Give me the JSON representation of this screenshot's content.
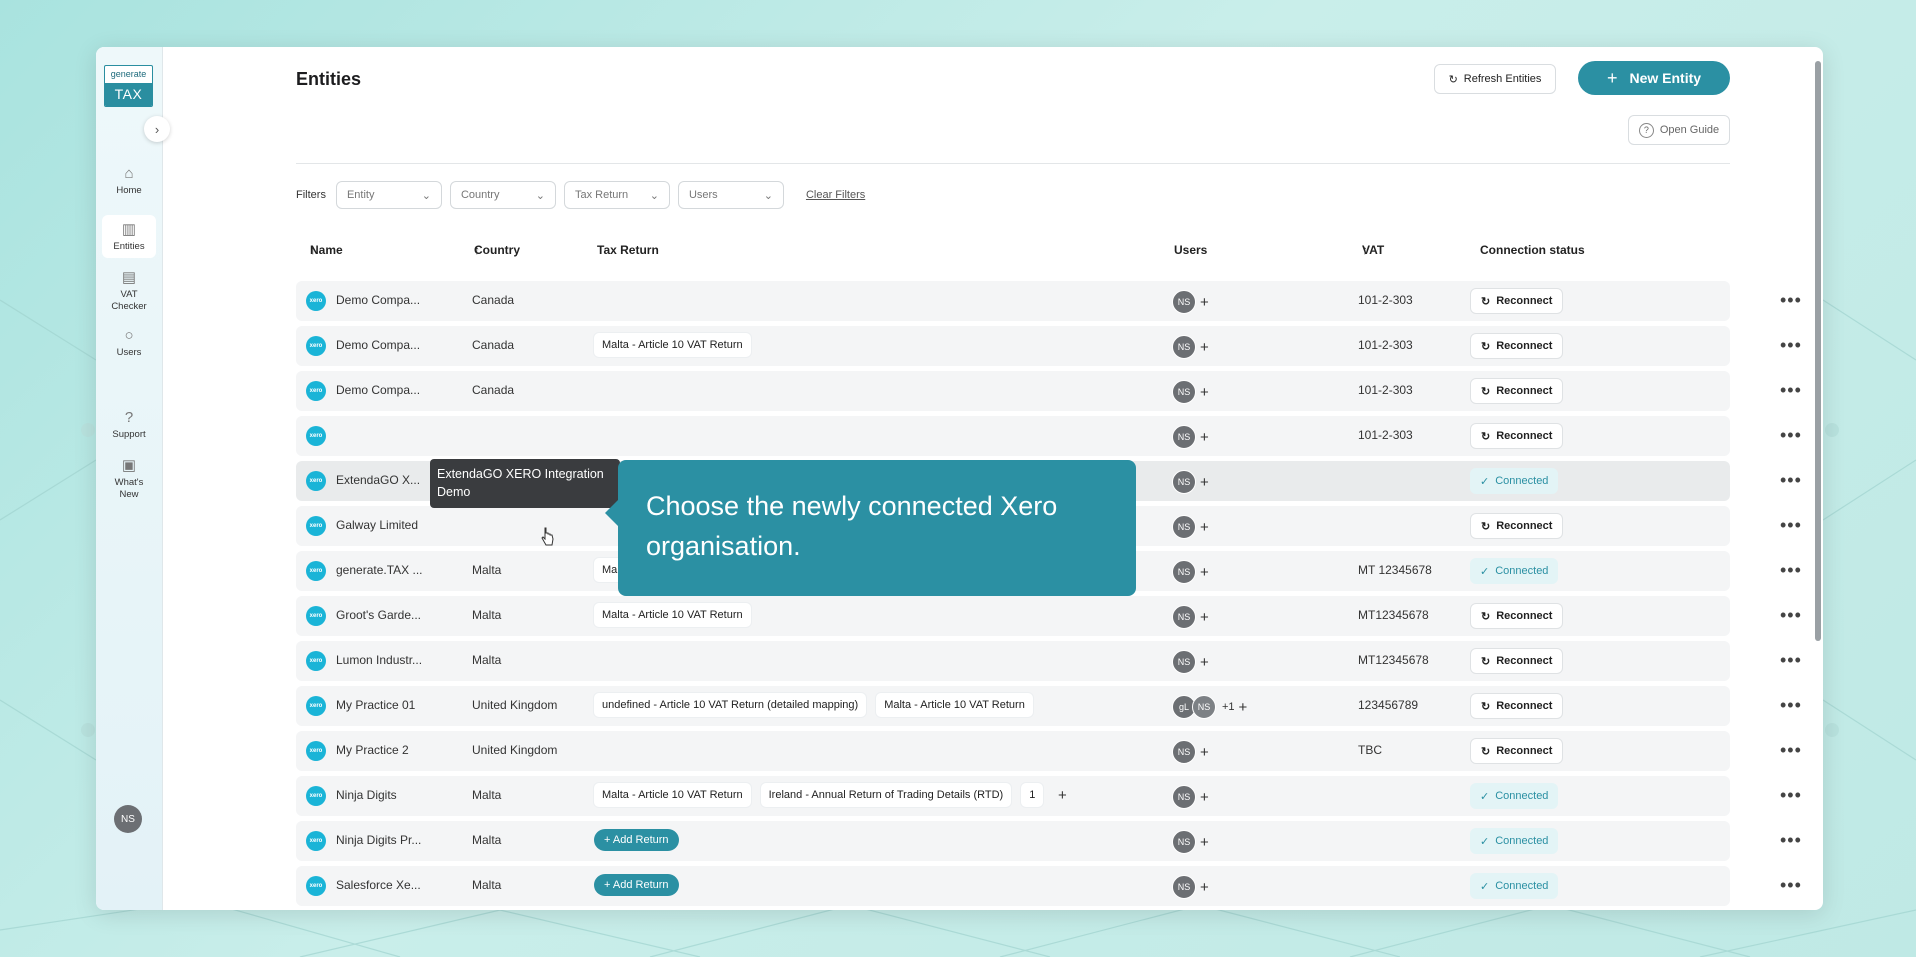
{
  "sidebar": {
    "logo_top": "generate",
    "logo_bottom": "TAX",
    "items": [
      {
        "label": "Home",
        "icon": "home-icon"
      },
      {
        "label": "Entities",
        "icon": "building-icon"
      },
      {
        "label": "VAT Checker",
        "icon": "document-icon"
      },
      {
        "label": "Users",
        "icon": "user-icon"
      },
      {
        "label": "Support",
        "icon": "help-icon"
      },
      {
        "label": "What's New",
        "icon": "news-icon"
      }
    ],
    "avatar": "NS"
  },
  "header": {
    "title": "Entities",
    "refresh_label": "Refresh Entities",
    "new_label": "New Entity",
    "guide_label": "Open Guide"
  },
  "filters": {
    "label": "Filters",
    "dropdowns": [
      "Entity",
      "Country",
      "Tax Return",
      "Users"
    ],
    "clear_label": "Clear Filters"
  },
  "table": {
    "columns": {
      "name": "Name",
      "country": "Country",
      "tax_return": "Tax Return",
      "users": "Users",
      "vat": "VAT",
      "status": "Connection status"
    },
    "rows": [
      {
        "name": "Demo Compa...",
        "country": "Canada",
        "returns": [],
        "users": [
          "NS"
        ],
        "extra": "",
        "vat": "101-2-303",
        "status": "Reconnect"
      },
      {
        "name": "Demo Compa...",
        "country": "Canada",
        "returns": [
          "Malta - Article 10 VAT Return"
        ],
        "users": [
          "NS"
        ],
        "extra": "",
        "vat": "101-2-303",
        "status": "Reconnect"
      },
      {
        "name": "Demo Compa...",
        "country": "Canada",
        "returns": [],
        "users": [
          "NS"
        ],
        "extra": "",
        "vat": "101-2-303",
        "status": "Reconnect"
      },
      {
        "name": "",
        "country": "",
        "returns": [],
        "users": [
          "NS"
        ],
        "extra": "",
        "vat": "101-2-303",
        "status": "Reconnect"
      },
      {
        "name": "ExtendaGO X...",
        "country": "",
        "returns": [],
        "users": [
          "NS"
        ],
        "extra": "",
        "vat": "",
        "status": "Connected"
      },
      {
        "name": "Galway Limited",
        "country": "",
        "returns": [],
        "users": [
          "NS"
        ],
        "extra": "",
        "vat": "",
        "status": "Reconnect"
      },
      {
        "name": "generate.TAX ...",
        "country": "Malta",
        "returns": [
          "Malta - Article 10 VAT Return"
        ],
        "users": [
          "NS"
        ],
        "extra": "",
        "vat": "MT 12345678",
        "status": "Connected"
      },
      {
        "name": "Groot's Garde...",
        "country": "Malta",
        "returns": [
          "Malta - Article 10 VAT Return"
        ],
        "users": [
          "NS"
        ],
        "extra": "",
        "vat": "MT12345678",
        "status": "Reconnect"
      },
      {
        "name": "Lumon Industr...",
        "country": "Malta",
        "returns": [],
        "users": [
          "NS"
        ],
        "extra": "",
        "vat": "MT12345678",
        "status": "Reconnect"
      },
      {
        "name": "My Practice 01",
        "country": "United Kingdom",
        "returns": [
          "undefined - Article 10 VAT Return (detailed mapping)",
          "Malta - Article 10 VAT Return"
        ],
        "users": [
          "gL",
          "NS"
        ],
        "extra": "+1",
        "vat": "123456789",
        "status": "Reconnect"
      },
      {
        "name": "My Practice 2",
        "country": "United Kingdom",
        "returns": [],
        "users": [
          "NS"
        ],
        "extra": "",
        "vat": "TBC",
        "status": "Reconnect"
      },
      {
        "name": "Ninja Digits",
        "country": "Malta",
        "returns": [
          "Malta - Article 10 VAT Return",
          "Ireland - Annual Return of Trading Details (RTD)",
          "1"
        ],
        "users": [
          "NS"
        ],
        "extra": "",
        "vat": "",
        "status": "Connected"
      },
      {
        "name": "Ninja Digits Pr...",
        "country": "Malta",
        "returns": [],
        "users": [
          "NS"
        ],
        "extra": "",
        "vat": "",
        "status": "Connected"
      },
      {
        "name": "Salesforce Xe...",
        "country": "Malta",
        "returns": [],
        "users": [
          "NS"
        ],
        "extra": "",
        "vat": "",
        "status": "Connected"
      }
    ],
    "add_return_label": "Add Return",
    "xero_badge": "xero"
  },
  "tooltip": {
    "text": "ExtendaGO XERO Integration Demo"
  },
  "callout": {
    "text": "Choose the newly connected Xero organisation."
  },
  "colors": {
    "accent": "#2b90a3",
    "xero": "#1ab4d7",
    "avatar": "#6c6f73"
  }
}
